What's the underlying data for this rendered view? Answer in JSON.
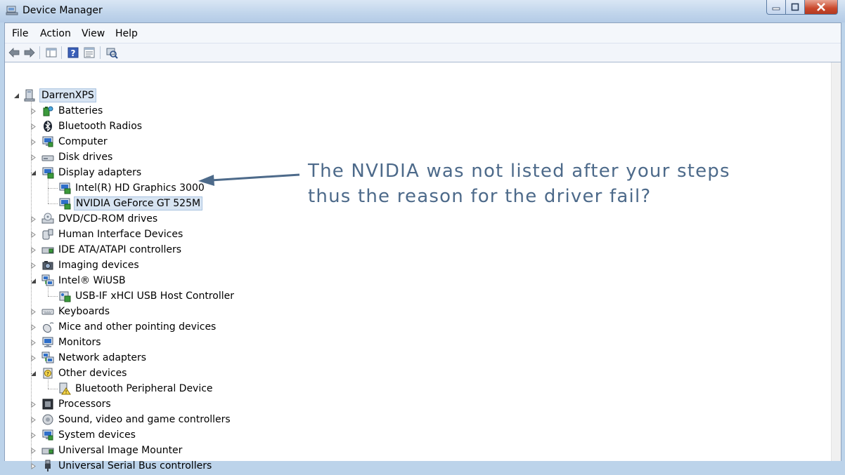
{
  "window": {
    "title": "Device Manager",
    "minimize_glyph": "–",
    "maximize_glyph": "□",
    "close_glyph": "✕"
  },
  "menu": [
    "File",
    "Action",
    "View",
    "Help"
  ],
  "toolbar": {
    "icons": [
      "back-arrow-icon",
      "forward-arrow-icon",
      "show-hide-console-tree-icon",
      "help-icon",
      "properties-icon",
      "scan-hardware-changes-icon"
    ]
  },
  "tree": {
    "root": "DarrenXPS",
    "nodes": [
      {
        "label": "Batteries",
        "icon": "battery-icon",
        "expanded": false
      },
      {
        "label": "Bluetooth Radios",
        "icon": "bluetooth-icon",
        "expanded": false
      },
      {
        "label": "Computer",
        "icon": "computer-icon",
        "expanded": false
      },
      {
        "label": "Disk drives",
        "icon": "disk-drive-icon",
        "expanded": false
      },
      {
        "label": "Display adapters",
        "icon": "display-adapter-icon",
        "expanded": true,
        "children": [
          {
            "label": "Intel(R) HD Graphics 3000",
            "icon": "display-adapter-icon"
          },
          {
            "label": "NVIDIA GeForce GT 525M",
            "icon": "display-adapter-icon",
            "selected": true
          }
        ]
      },
      {
        "label": "DVD/CD-ROM drives",
        "icon": "dvd-drive-icon",
        "expanded": false
      },
      {
        "label": "Human Interface Devices",
        "icon": "hid-icon",
        "expanded": false
      },
      {
        "label": "IDE ATA/ATAPI controllers",
        "icon": "ide-controller-icon",
        "expanded": false
      },
      {
        "label": "Imaging devices",
        "icon": "camera-icon",
        "expanded": false
      },
      {
        "label": "Intel® WiUSB",
        "icon": "network-icon",
        "expanded": true,
        "children": [
          {
            "label": "USB-IF xHCI USB Host Controller",
            "icon": "usb-controller-icon"
          }
        ]
      },
      {
        "label": "Keyboards",
        "icon": "keyboard-icon",
        "expanded": false
      },
      {
        "label": "Mice and other pointing devices",
        "icon": "mouse-icon",
        "expanded": false
      },
      {
        "label": "Monitors",
        "icon": "monitor-icon",
        "expanded": false
      },
      {
        "label": "Network adapters",
        "icon": "network-icon",
        "expanded": false
      },
      {
        "label": "Other devices",
        "icon": "unknown-device-icon",
        "expanded": true,
        "children": [
          {
            "label": "Bluetooth Peripheral Device",
            "icon": "warning-device-icon"
          }
        ]
      },
      {
        "label": "Processors",
        "icon": "processor-icon",
        "expanded": false
      },
      {
        "label": "Sound, video and game controllers",
        "icon": "sound-icon",
        "expanded": false
      },
      {
        "label": "System devices",
        "icon": "computer-icon",
        "expanded": false
      },
      {
        "label": "Universal Image Mounter",
        "icon": "ide-controller-icon",
        "expanded": false
      },
      {
        "label": "Universal Serial Bus controllers",
        "icon": "usb-plug-icon",
        "expanded": false
      }
    ]
  },
  "annotation": {
    "line1": "The NVIDIA was not listed after your steps",
    "line2": "thus the reason for the driver fail?",
    "color": "#4d6a8a"
  }
}
